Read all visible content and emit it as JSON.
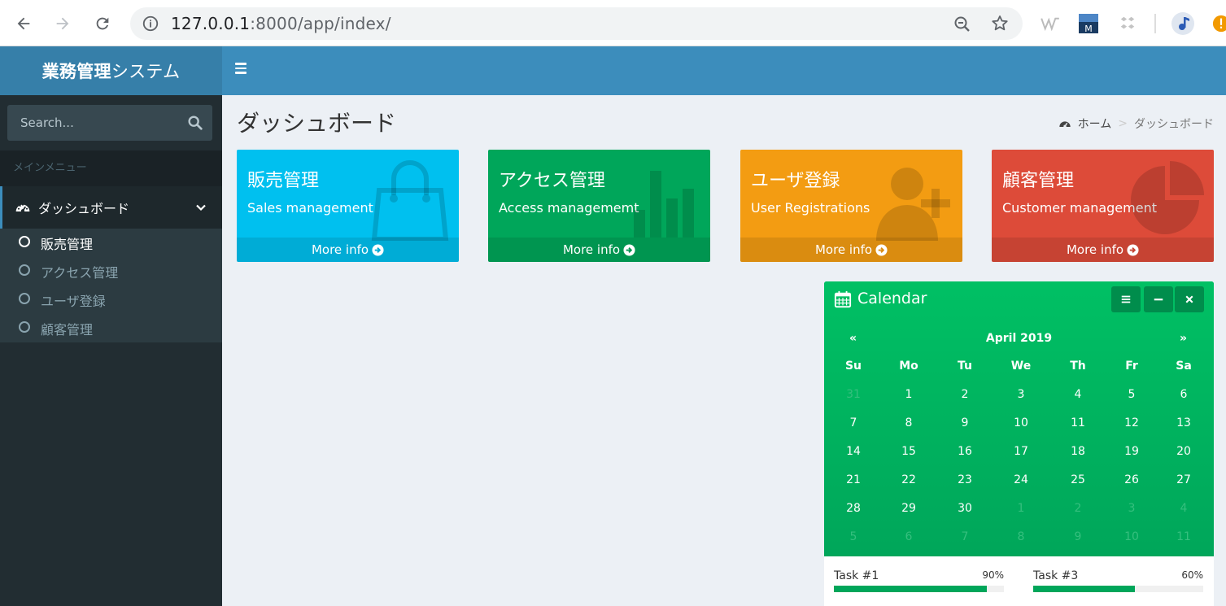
{
  "browser": {
    "url_host": "127.0.0.1",
    "url_rest": ":8000/app/index/"
  },
  "header": {
    "logo_bold": "業務管理",
    "logo_rest": "システム"
  },
  "sidebar": {
    "search_placeholder": "Search...",
    "menu_header": "メインメニュー",
    "active_item": "ダッシュボード",
    "sub_items": [
      {
        "label": "販売管理"
      },
      {
        "label": "アクセス管理"
      },
      {
        "label": "ユーザ登録"
      },
      {
        "label": "顧客管理"
      }
    ]
  },
  "content": {
    "page_title": "ダッシュボード",
    "breadcrumb": {
      "home": "ホーム",
      "separator": ">",
      "current": "ダッシュボード"
    }
  },
  "boxes": [
    {
      "title": "販売管理",
      "sub": "Sales management",
      "footer": "More info",
      "color": "#00c0ef",
      "icon": "shopping-bag-icon"
    },
    {
      "title": "アクセス管理",
      "sub": "Access managememt",
      "footer": "More info",
      "color": "#00a65a",
      "icon": "bar-chart-icon"
    },
    {
      "title": "ユーザ登録",
      "sub": "User Registrations",
      "footer": "More info",
      "color": "#f39c12",
      "icon": "user-plus-icon"
    },
    {
      "title": "顧客管理",
      "sub": "Customer management",
      "footer": "More info",
      "color": "#dd4b39",
      "icon": "pie-chart-icon"
    }
  ],
  "calendar": {
    "title": "Calendar",
    "prev": "«",
    "next": "»",
    "month": "April 2019",
    "dow": [
      "Su",
      "Mo",
      "Tu",
      "We",
      "Th",
      "Fr",
      "Sa"
    ],
    "weeks": [
      [
        {
          "d": "31",
          "m": true
        },
        {
          "d": "1"
        },
        {
          "d": "2"
        },
        {
          "d": "3"
        },
        {
          "d": "4"
        },
        {
          "d": "5"
        },
        {
          "d": "6"
        }
      ],
      [
        {
          "d": "7"
        },
        {
          "d": "8"
        },
        {
          "d": "9"
        },
        {
          "d": "10"
        },
        {
          "d": "11"
        },
        {
          "d": "12"
        },
        {
          "d": "13"
        }
      ],
      [
        {
          "d": "14"
        },
        {
          "d": "15"
        },
        {
          "d": "16"
        },
        {
          "d": "17"
        },
        {
          "d": "18"
        },
        {
          "d": "19"
        },
        {
          "d": "20"
        }
      ],
      [
        {
          "d": "21"
        },
        {
          "d": "22"
        },
        {
          "d": "23"
        },
        {
          "d": "24"
        },
        {
          "d": "25"
        },
        {
          "d": "26"
        },
        {
          "d": "27"
        }
      ],
      [
        {
          "d": "28"
        },
        {
          "d": "29"
        },
        {
          "d": "30"
        },
        {
          "d": "1",
          "m": true
        },
        {
          "d": "2",
          "m": true
        },
        {
          "d": "3",
          "m": true
        },
        {
          "d": "4",
          "m": true
        }
      ],
      [
        {
          "d": "5",
          "m": true
        },
        {
          "d": "6",
          "m": true
        },
        {
          "d": "7",
          "m": true
        },
        {
          "d": "8",
          "m": true
        },
        {
          "d": "9",
          "m": true
        },
        {
          "d": "10",
          "m": true
        },
        {
          "d": "11",
          "m": true
        }
      ]
    ]
  },
  "tasks": [
    {
      "name": "Task #1",
      "pct_label": "90%",
      "pct": 90
    },
    {
      "name": "Task #3",
      "pct_label": "60%",
      "pct": 60
    }
  ]
}
